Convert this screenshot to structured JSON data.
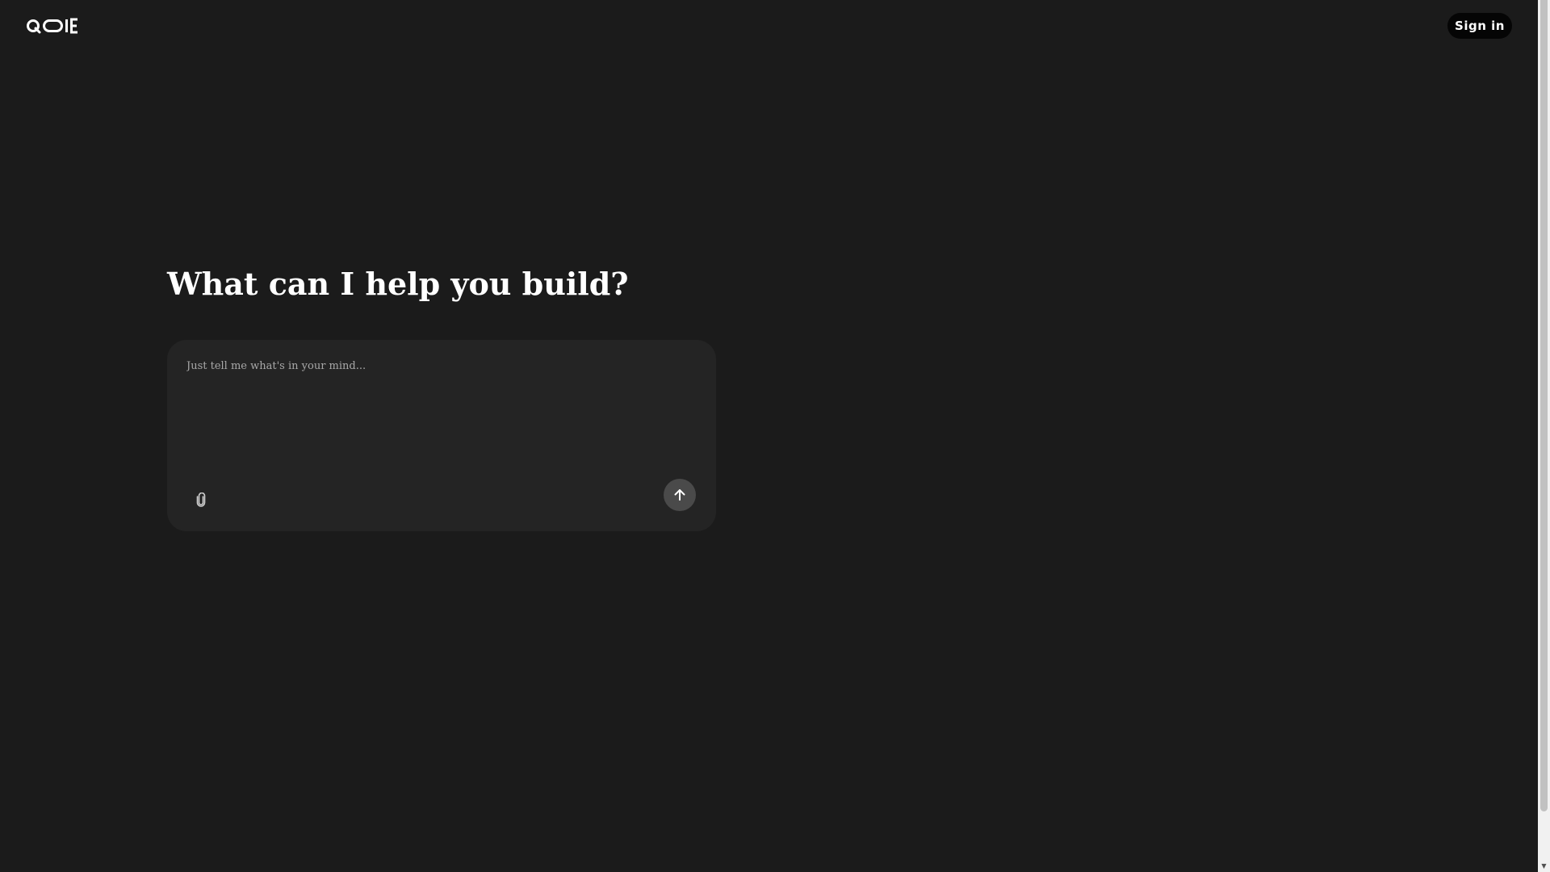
{
  "header": {
    "logo_icon": "qoie-wordmark-icon",
    "signin_label": "Sign in"
  },
  "main": {
    "headline": "What can I help you build?",
    "composer": {
      "placeholder": "Just tell me what's in your mind...",
      "value": "",
      "attach_icon": "paperclip-icon",
      "send_icon": "arrow-up-icon"
    }
  },
  "scrollbar": {
    "position": 1.0
  },
  "colors": {
    "background": "#1b1b1b",
    "composer_bg": "#242424",
    "send_button_bg": "#4a4a4a",
    "signin_bg": "#050505",
    "text_primary": "#ffffff",
    "placeholder": "#a8a8a8"
  }
}
